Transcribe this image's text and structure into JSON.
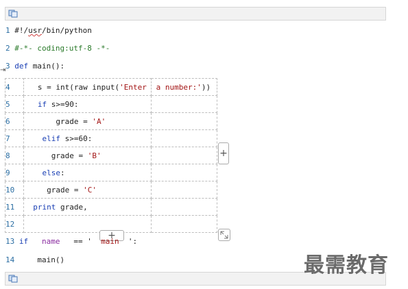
{
  "watermark": "最需教育",
  "lines_before": [
    {
      "num": "1",
      "segments": [
        {
          "t": "#!/",
          "c": "plain"
        },
        {
          "t": "usr",
          "c": "squig"
        },
        {
          "t": "/bin/python",
          "c": "plain"
        }
      ]
    },
    {
      "num": "2",
      "segments": [
        {
          "t": "#-*- coding:utf-8 -*-",
          "c": "cm"
        }
      ]
    },
    {
      "num": "3",
      "segments": [
        {
          "t": "def",
          "c": "kw"
        },
        {
          "t": " main():",
          "c": "plain"
        }
      ]
    }
  ],
  "table_rows": [
    {
      "num": "4",
      "segments": [
        {
          "t": "   s = int(raw input(",
          "c": "plain"
        },
        {
          "t": "'Enter",
          "c": "str"
        }
      ],
      "col3": [
        {
          "t": " a number:'",
          "c": "str"
        },
        {
          "t": "))",
          "c": "plain"
        }
      ]
    },
    {
      "num": "5",
      "segments": [
        {
          "t": "   ",
          "c": "plain"
        },
        {
          "t": "if",
          "c": "kw"
        },
        {
          "t": " s>=90:",
          "c": "plain"
        }
      ],
      "col3": []
    },
    {
      "num": "6",
      "segments": [
        {
          "t": "       grade = ",
          "c": "plain"
        },
        {
          "t": "'A'",
          "c": "str"
        }
      ],
      "col3": []
    },
    {
      "num": "7",
      "segments": [
        {
          "t": "    ",
          "c": "plain"
        },
        {
          "t": "elif",
          "c": "kw"
        },
        {
          "t": " s>=60:",
          "c": "plain"
        }
      ],
      "col3": []
    },
    {
      "num": "8",
      "segments": [
        {
          "t": "      grade = ",
          "c": "plain"
        },
        {
          "t": "'B'",
          "c": "str"
        }
      ],
      "col3": []
    },
    {
      "num": "9",
      "segments": [
        {
          "t": "    ",
          "c": "plain"
        },
        {
          "t": "else",
          "c": "kw"
        },
        {
          "t": ":",
          "c": "plain"
        }
      ],
      "col3": []
    },
    {
      "num": "10",
      "segments": [
        {
          "t": "     grade = ",
          "c": "plain"
        },
        {
          "t": "'C'",
          "c": "str"
        }
      ],
      "col3": []
    },
    {
      "num": "11",
      "segments": [
        {
          "t": "  ",
          "c": "plain"
        },
        {
          "t": "print",
          "c": "kw"
        },
        {
          "t": " grade,",
          "c": "plain"
        }
      ],
      "col3": []
    },
    {
      "num": "12",
      "segments": [],
      "col3": []
    }
  ],
  "lines_after": [
    {
      "num": "13",
      "segments": [
        {
          "t": "if",
          "c": "kw"
        },
        {
          "t": "   ",
          "c": "plain"
        },
        {
          "t": "name",
          "c": "nm"
        },
        {
          "t": "   == '  ",
          "c": "plain"
        },
        {
          "t": "main",
          "c": "str"
        },
        {
          "t": "  ':",
          "c": "plain"
        }
      ]
    },
    {
      "num": "14",
      "segments": [
        {
          "t": "    main()",
          "c": "plain"
        }
      ]
    }
  ],
  "buttons": {
    "add_column": "+",
    "add_row": "+"
  }
}
